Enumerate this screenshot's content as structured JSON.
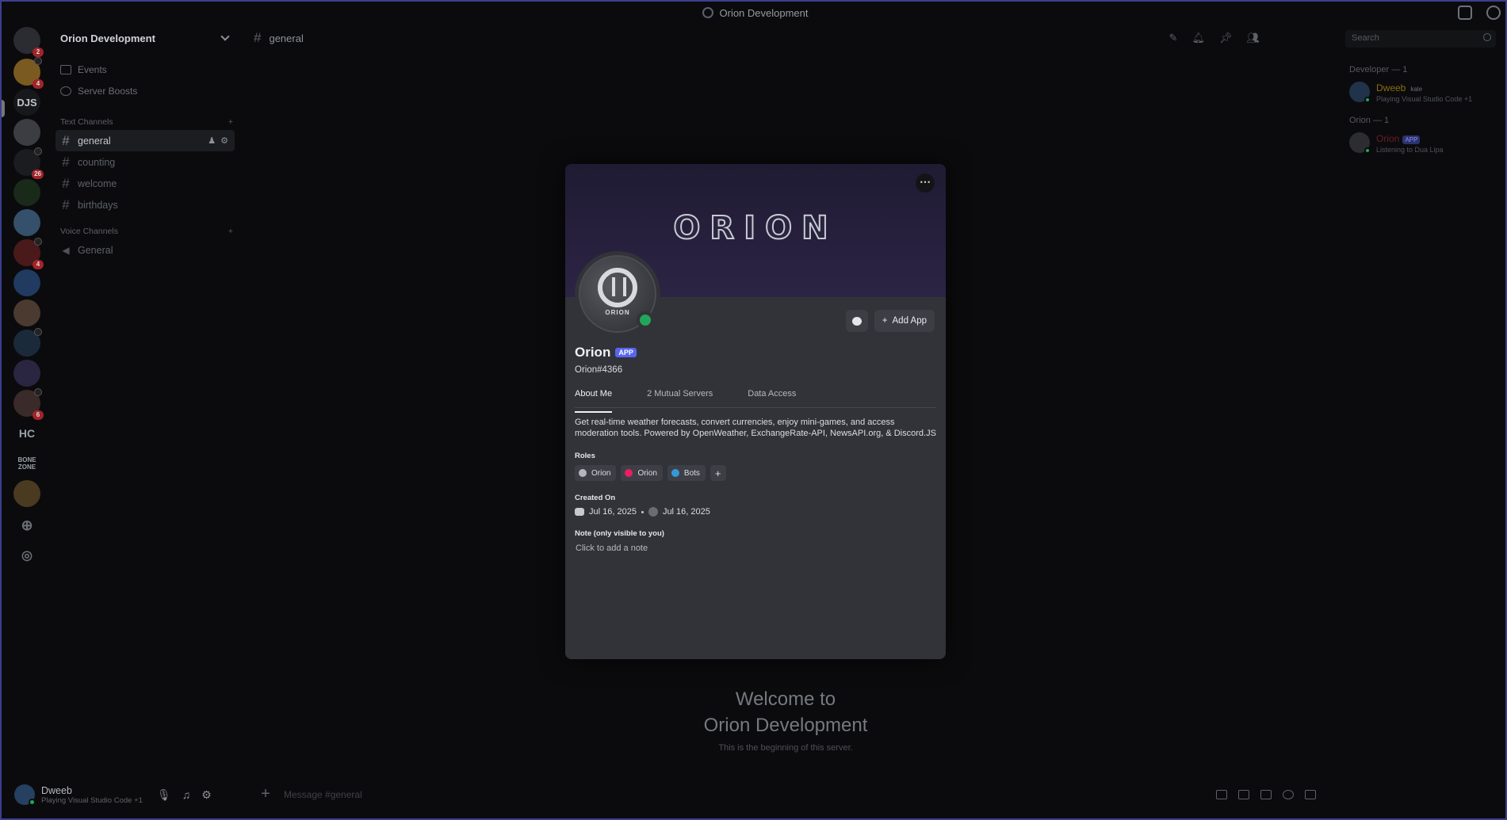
{
  "window": {
    "title": "Orion Development"
  },
  "rail": {
    "servers": [
      {
        "label": "",
        "badge": "2"
      },
      {
        "label": "",
        "badge": "4"
      },
      {
        "label": "DJS",
        "badge": ""
      },
      {
        "label": "",
        "badge": ""
      },
      {
        "label": "",
        "badge": "26"
      },
      {
        "label": "",
        "badge": ""
      },
      {
        "label": "",
        "badge": ""
      },
      {
        "label": "",
        "badge": "4"
      },
      {
        "label": "",
        "badge": ""
      },
      {
        "label": "",
        "badge": ""
      },
      {
        "label": "",
        "badge": ""
      },
      {
        "label": "",
        "badge": ""
      },
      {
        "label": "",
        "badge": "6"
      },
      {
        "label": "HC",
        "badge": ""
      },
      {
        "label": "BONE ZONE",
        "badge": ""
      },
      {
        "label": "",
        "badge": ""
      }
    ]
  },
  "sidebar": {
    "server_name": "Orion Development",
    "items": [
      {
        "label": "Events"
      },
      {
        "label": "Server Boosts"
      }
    ],
    "text_category": "Text Channels",
    "text_channels": [
      {
        "name": "general"
      },
      {
        "name": "counting"
      },
      {
        "name": "welcome"
      },
      {
        "name": "birthdays"
      }
    ],
    "voice_category": "Voice Channels",
    "voice_channels": [
      {
        "name": "General"
      }
    ]
  },
  "user": {
    "name": "Dweeb",
    "status": "Playing Visual Studio Code +1"
  },
  "channel": {
    "name": "general"
  },
  "search": {
    "placeholder": "Search"
  },
  "welcome": {
    "line1": "Welcome to",
    "line2": "Orion Development",
    "sub": "This is the beginning of this server."
  },
  "composer": {
    "placeholder": "Message #general"
  },
  "members": {
    "developer_category": "Developer — 1",
    "developer": {
      "name": "Dweeb",
      "tag": "kale",
      "activity": "Playing Visual Studio Code +1"
    },
    "orion_category": "Orion — 1",
    "orion": {
      "name": "Orion",
      "tag": "APP",
      "activity": "Listening to Dua Lipa"
    }
  },
  "profile": {
    "banner_text": "ORION",
    "avatar_text": "ORION",
    "add_app_label": "Add App",
    "name": "Orion",
    "badge": "APP",
    "tag": "Orion#4366",
    "tabs": [
      {
        "label": "About Me"
      },
      {
        "label": "2 Mutual Servers"
      },
      {
        "label": "Data Access"
      }
    ],
    "about": "Get real-time weather forecasts, convert currencies, enjoy mini-games, and access moderation tools. Powered by OpenWeather,  ExchangeRate-API, NewsAPI.org, & Discord.JS",
    "roles_heading": "Roles",
    "roles": [
      {
        "label": "Orion",
        "color": "#b5b6bc"
      },
      {
        "label": "Orion",
        "color": "#e91e63"
      },
      {
        "label": "Bots",
        "color": "#3498db"
      }
    ],
    "created_heading": "Created On",
    "created_discord": "Jul 16, 2025",
    "created_server": "Jul 16, 2025",
    "note_heading": "Note (only visible to you)",
    "note_placeholder": "Click to add a note"
  }
}
